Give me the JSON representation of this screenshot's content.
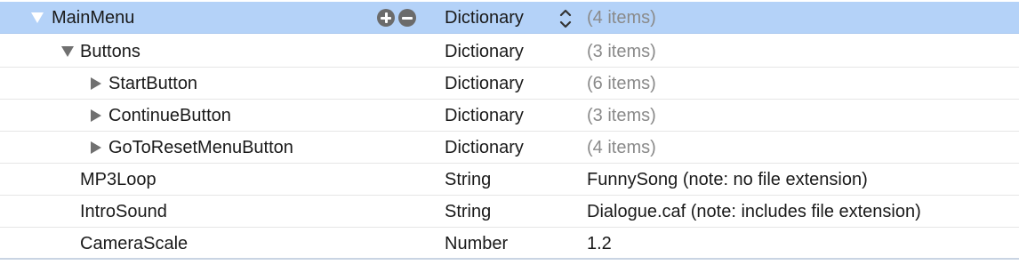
{
  "rows": [
    {
      "key": "MainMenu",
      "type": "Dictionary",
      "value": "(4 items)"
    },
    {
      "key": "Buttons",
      "type": "Dictionary",
      "value": "(3 items)"
    },
    {
      "key": "StartButton",
      "type": "Dictionary",
      "value": "(6 items)"
    },
    {
      "key": "ContinueButton",
      "type": "Dictionary",
      "value": "(3 items)"
    },
    {
      "key": "GoToResetMenuButton",
      "type": "Dictionary",
      "value": "(4 items)"
    },
    {
      "key": "MP3Loop",
      "type": "String",
      "value": "FunnySong (note: no file extension)"
    },
    {
      "key": "IntroSound",
      "type": "String",
      "value": "Dialogue.caf (note: includes file extension)"
    },
    {
      "key": "CameraScale",
      "type": "Number",
      "value": "1.2"
    }
  ],
  "icons": {
    "add": "plus-circle-icon",
    "remove": "minus-circle-icon",
    "stepper": "up-down-chevron-icon",
    "expanded": "disclosure-triangle-down-icon",
    "collapsed": "disclosure-triangle-right-icon"
  },
  "colors": {
    "selection": "#b4d2f8",
    "muted_value": "#8a8a8a"
  }
}
